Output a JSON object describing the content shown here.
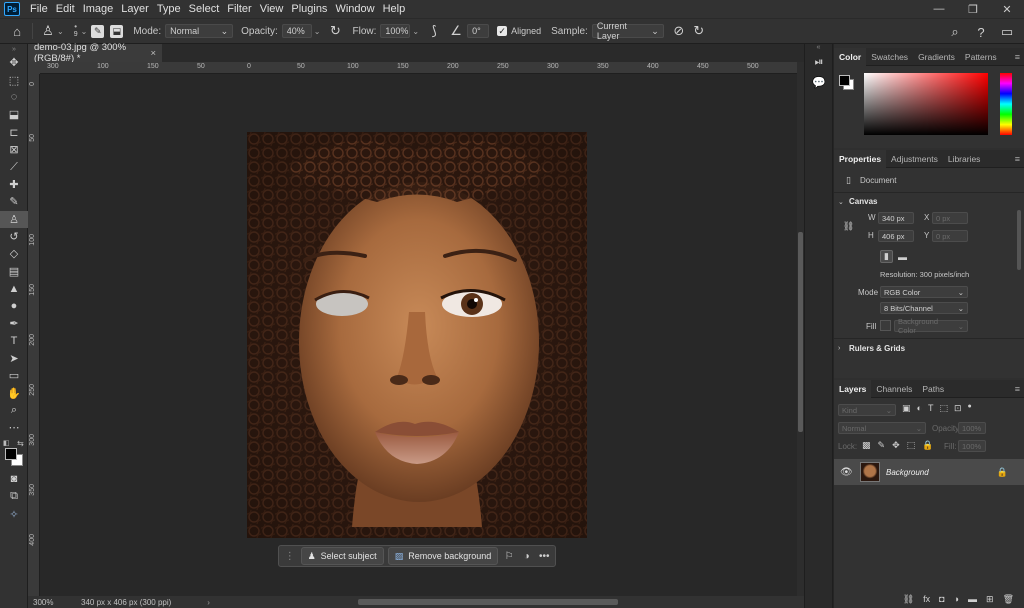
{
  "app": {
    "logo": "Ps",
    "menu": [
      "File",
      "Edit",
      "Image",
      "Layer",
      "Type",
      "Select",
      "Filter",
      "View",
      "Plugins",
      "Window",
      "Help"
    ],
    "window_controls": [
      "—",
      "❐",
      "✕"
    ]
  },
  "options": {
    "brush_size": "9",
    "mode_label": "Mode:",
    "mode_value": "Normal",
    "opacity_label": "Opacity:",
    "opacity_value": "40%",
    "flow_label": "Flow:",
    "flow_value": "100%",
    "angle_value": "0°",
    "aligned_label": "Aligned",
    "sample_label": "Sample:",
    "sample_value": "Current Layer"
  },
  "document": {
    "tab_title": "demo-03.jpg @ 300% (RGB/8#) *",
    "close": "×",
    "zoom": "300%",
    "doc_info": "340 px x 406 px (300 ppi)",
    "status_arrow": "›"
  },
  "rulers": {
    "h_ticks": [
      "300",
      "100",
      "150",
      "50",
      "0",
      "50",
      "100",
      "150",
      "200",
      "250",
      "300",
      "350",
      "400",
      "450",
      "500"
    ],
    "v_ticks": [
      "0",
      "50",
      "100",
      "150",
      "200",
      "250",
      "300",
      "350",
      "400"
    ]
  },
  "contextual_bar": {
    "select_subject": "Select subject",
    "remove_background": "Remove background",
    "more": "•••"
  },
  "color_panel": {
    "tabs": [
      "Color",
      "Swatches",
      "Gradients",
      "Patterns"
    ],
    "foreground": "#000000",
    "background": "#ffffff",
    "hue": "#ff0000"
  },
  "properties_panel": {
    "tabs": [
      "Properties",
      "Adjustments",
      "Libraries"
    ],
    "doc_label": "Document",
    "canvas_section": "Canvas",
    "w_label": "W",
    "w_value": "340 px",
    "h_label": "H",
    "h_value": "406 px",
    "x_label": "X",
    "x_value": "0 px",
    "y_label": "Y",
    "y_value": "0 px",
    "resolution": "Resolution: 300 pixels/inch",
    "mode_label": "Mode",
    "mode_value": "RGB Color",
    "bits_value": "8 Bits/Channel",
    "fill_label": "Fill",
    "fill_value": "Background Color",
    "rulers_section": "Rulers & Grids"
  },
  "layers_panel": {
    "tabs": [
      "Layers",
      "Channels",
      "Paths"
    ],
    "kind_placeholder": "Kind",
    "blend_mode": "Normal",
    "opacity_label": "Opacity:",
    "opacity_value": "100%",
    "lock_label": "Lock:",
    "fill_label": "Fill:",
    "fill_value": "100%",
    "layer_name": "Background",
    "filter_icons": [
      "▣",
      "◐",
      "T",
      "⬚",
      "⊡"
    ],
    "footer_icons": [
      "⛓",
      "fx",
      "◘",
      "◑",
      "▬",
      "⊞",
      "🗑"
    ]
  }
}
